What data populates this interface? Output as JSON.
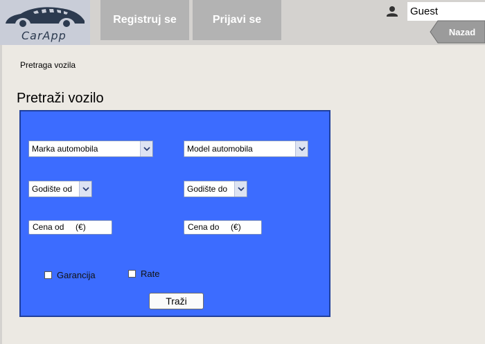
{
  "header": {
    "logo_text": "CarApp",
    "nav": {
      "register": "Registruj se",
      "login": "Prijavi se"
    },
    "user": {
      "name": "Guest"
    },
    "back_label": "Nazad"
  },
  "breadcrumb": "Pretraga vozila",
  "page_title": "Pretraži vozilo",
  "search": {
    "make": {
      "value": "Marka automobila"
    },
    "model": {
      "value": "Model automobila"
    },
    "year_from": {
      "value": "Godište od"
    },
    "year_to": {
      "value": "Godište do"
    },
    "price_from": {
      "value": "Cena od     (€)"
    },
    "price_to": {
      "value": "Cena do     (€)"
    },
    "warranty": {
      "label": "Garancija",
      "checked": false
    },
    "installments": {
      "label": "Rate",
      "checked": false
    },
    "submit_label": "Traži"
  },
  "colors": {
    "panel": "#3c6cff",
    "nav_button": "#b3b3b3",
    "back_button": "#9b9b9b"
  }
}
